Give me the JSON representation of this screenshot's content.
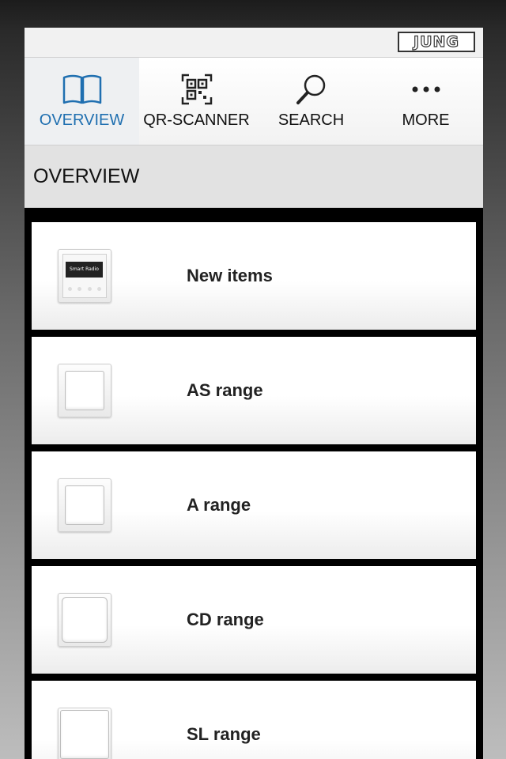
{
  "brand": {
    "logo_text": "JUNG"
  },
  "tabs": [
    {
      "label": "OVERVIEW",
      "icon": "book-icon",
      "active": true
    },
    {
      "label": "QR-SCANNER",
      "icon": "qr-code-icon",
      "active": false
    },
    {
      "label": "SEARCH",
      "icon": "search-icon",
      "active": false
    },
    {
      "label": "MORE",
      "icon": "more-icon",
      "active": false
    }
  ],
  "header": {
    "title": "OVERVIEW"
  },
  "items": [
    {
      "label": "New items",
      "thumb": "smart-radio-thumbnail",
      "thumb_text": "Smart Radio"
    },
    {
      "label": "AS range",
      "thumb": "switch-thumbnail"
    },
    {
      "label": "A range",
      "thumb": "switch-thumbnail"
    },
    {
      "label": "CD range",
      "thumb": "switch-thumbnail"
    },
    {
      "label": "SL range",
      "thumb": "switch-thumbnail"
    }
  ],
  "colors": {
    "accent": "#1f6fb0",
    "header_bg": "#e2e2e2",
    "list_bg": "#000000"
  }
}
